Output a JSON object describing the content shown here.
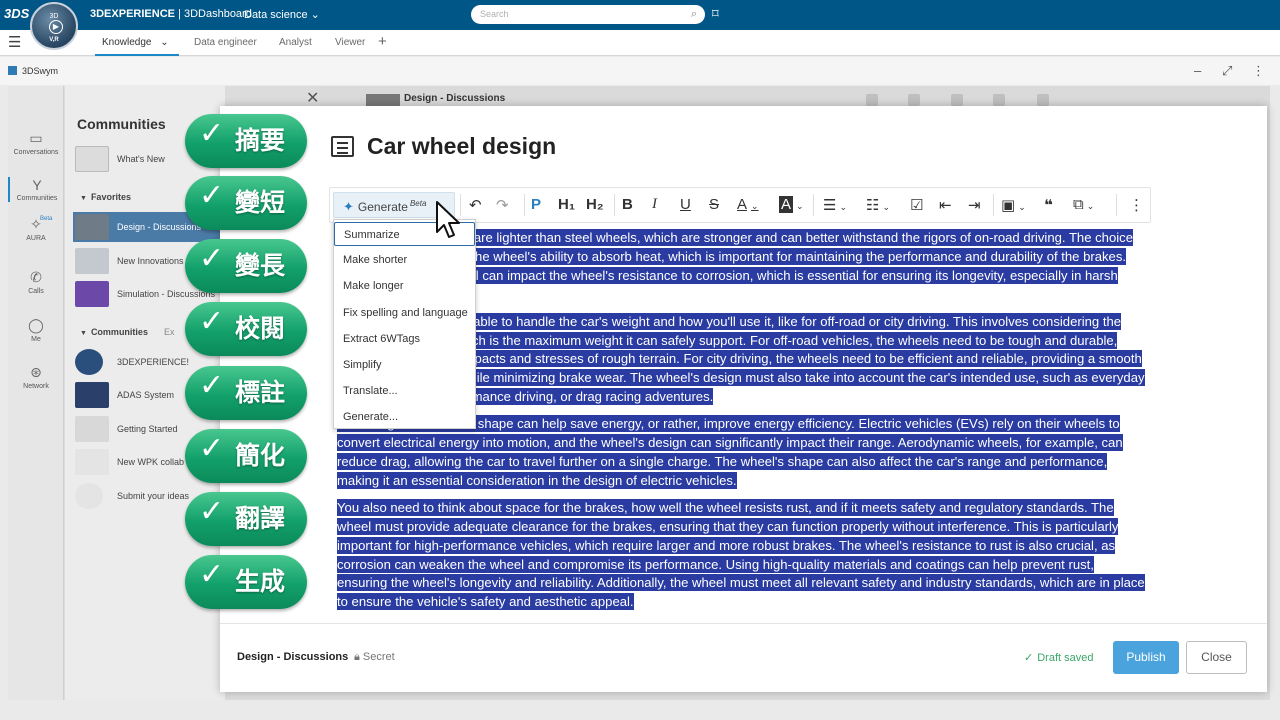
{
  "topbar": {
    "brand": "3DS",
    "compass_top": "3D",
    "compass_vr": "V,R",
    "app_title_bold": "3DEXPERIENCE",
    "app_title_rest": " | 3DDashboard",
    "context": "Data science",
    "search_placeholder": "Search"
  },
  "tabs": {
    "items": [
      "Knowledge",
      "Data engineer",
      "Analyst",
      "Viewer"
    ],
    "active": "Knowledge"
  },
  "widget": {
    "label": "3DSwym"
  },
  "leftnav": {
    "items": [
      "Conversations",
      "Communities",
      "AURA",
      "Calls",
      "Me",
      "Network"
    ],
    "beta": "Beta"
  },
  "communities": {
    "title": "Communities",
    "whats_new": "What's New",
    "favorites_label": "Favorites",
    "favorites": [
      "Design - Discussions",
      "New Innovations",
      "Simulation - Discussions"
    ],
    "communities_label": "Communities",
    "communities_extra": "Ex",
    "list": [
      "3DEXPERIENCE!",
      "ADAS System",
      "Getting Started",
      "New WPK collab",
      "Submit your ideas"
    ]
  },
  "behind": {
    "title": "Design - Discussions"
  },
  "editor": {
    "doc_title": "Car wheel design",
    "generate_label": "Generate",
    "generate_badge": "Beta",
    "menu": [
      "Summarize",
      "Make shorter",
      "Make longer",
      "Fix spelling and language",
      "Extract 6WTags",
      "Simplify",
      "Translate...",
      "Generate..."
    ],
    "paragraphs": [
      "Aluminum alloy wheels are lighter than steel wheels, which are stronger and can better withstand the rigors of on-road driving. The choice of material also affects the wheel's ability to absorb heat, which is important for maintaining the performance and durability of the brakes. Additionally, the material can impact the wheel's resistance to corrosion, which is essential for ensuring its longevity, especially in harsh driving conditions.",
      "The wheels need to be able to handle the car's weight and how you'll use it, like for off-road or city driving. This involves considering the wheel's load rating, which is the maximum weight it can safely support. For off-road vehicles, the wheels need to be tough and durable, able to withstand the impacts and stresses of rough terrain. For city driving, the wheels need to be efficient and reliable, providing a smooth and comfortable ride while minimizing brake wear. The wheel's design must also take into account the car's intended use, such as everyday commuting, high-performance driving, or drag racing adventures.",
      "The design of a wheel's shape can help save energy, or rather, improve energy efficiency. Electric vehicles (EVs) rely on their wheels to convert electrical energy into motion, and the wheel's design can significantly impact their range. Aerodynamic wheels, for example, can reduce drag, allowing the car to travel further on a single charge. The wheel's shape can also affect the car's range and performance, making it an essential consideration in the design of electric vehicles.",
      "You also need to think about space for the brakes, how well the wheel resists rust, and if it meets safety and regulatory standards. The wheel must provide adequate clearance for the brakes, ensuring that they can function properly without interference. This is particularly important for high-performance vehicles, which require larger and more robust brakes. The wheel's resistance to rust is also crucial, as corrosion can weaken the wheel and compromise its performance. Using high-quality materials and coatings can help prevent rust, ensuring the wheel's longevity and reliability. Additionally, the wheel must meet all relevant safety and industry standards, which are in place to ensure the vehicle's safety and aesthetic appeal."
    ]
  },
  "overlay_pills": [
    "摘要",
    "變短",
    "變長",
    "校閱",
    "標註",
    "簡化",
    "翻譯",
    "生成"
  ],
  "footer": {
    "community": "Design - Discussions",
    "visibility": "Secret",
    "draft_status": "Draft saved",
    "publish": "Publish",
    "close": "Close"
  },
  "colors": {
    "topbar": "#005686",
    "selection": "#2a3ca1",
    "publish": "#4aa3dc",
    "pill": "#12a06b",
    "draft": "#3aa66a"
  },
  "icons": [
    "search-icon",
    "tag-icon",
    "menu-icon",
    "plus-icon",
    "sparkle-icon",
    "undo-icon",
    "redo-icon",
    "bold-icon",
    "italic-icon",
    "underline-icon",
    "strikethrough-icon",
    "image-icon",
    "quote-icon",
    "more-icon",
    "check-icon",
    "lock-icon",
    "cursor-pointer-icon"
  ]
}
